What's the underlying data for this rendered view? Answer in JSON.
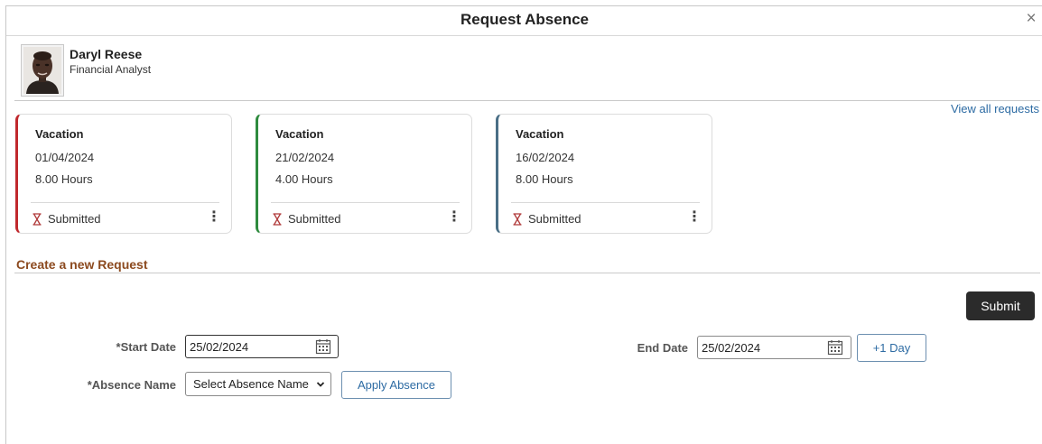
{
  "dialog": {
    "title": "Request Absence",
    "close_glyph": "×"
  },
  "employee": {
    "name": "Daryl Reese",
    "job_title": "Financial Analyst",
    "photo_icon": "employee-photo"
  },
  "requests": {
    "view_all_label": "View all requests",
    "cards": [
      {
        "type": "Vacation",
        "date": "01/04/2024",
        "hours": "8.00 Hours",
        "status": "Submitted",
        "accent": "#c0282d"
      },
      {
        "type": "Vacation",
        "date": "21/02/2024",
        "hours": "4.00 Hours",
        "status": "Submitted",
        "accent": "#2e8b3e"
      },
      {
        "type": "Vacation",
        "date": "16/02/2024",
        "hours": "8.00 Hours",
        "status": "Submitted",
        "accent": "#4a6f86"
      }
    ],
    "status_icon": "hourglass-icon",
    "status_icon_color": "#b03a3a",
    "more_glyph": "⋮"
  },
  "new_request": {
    "section_title": "Create a new Request",
    "submit_label": "Submit",
    "start_date_label": "*Start Date",
    "start_date_value": "25/02/2024",
    "end_date_label": "End Date",
    "end_date_value": "25/02/2024",
    "plus_day_label": "+1 Day",
    "absence_name_label": "*Absence Name",
    "absence_name_selected": "Select Absence Name",
    "apply_absence_label": "Apply Absence"
  },
  "colors": {
    "link": "#2d6ba3",
    "section_title": "#8c4a1f",
    "primary_button": "#2b2b2b"
  }
}
